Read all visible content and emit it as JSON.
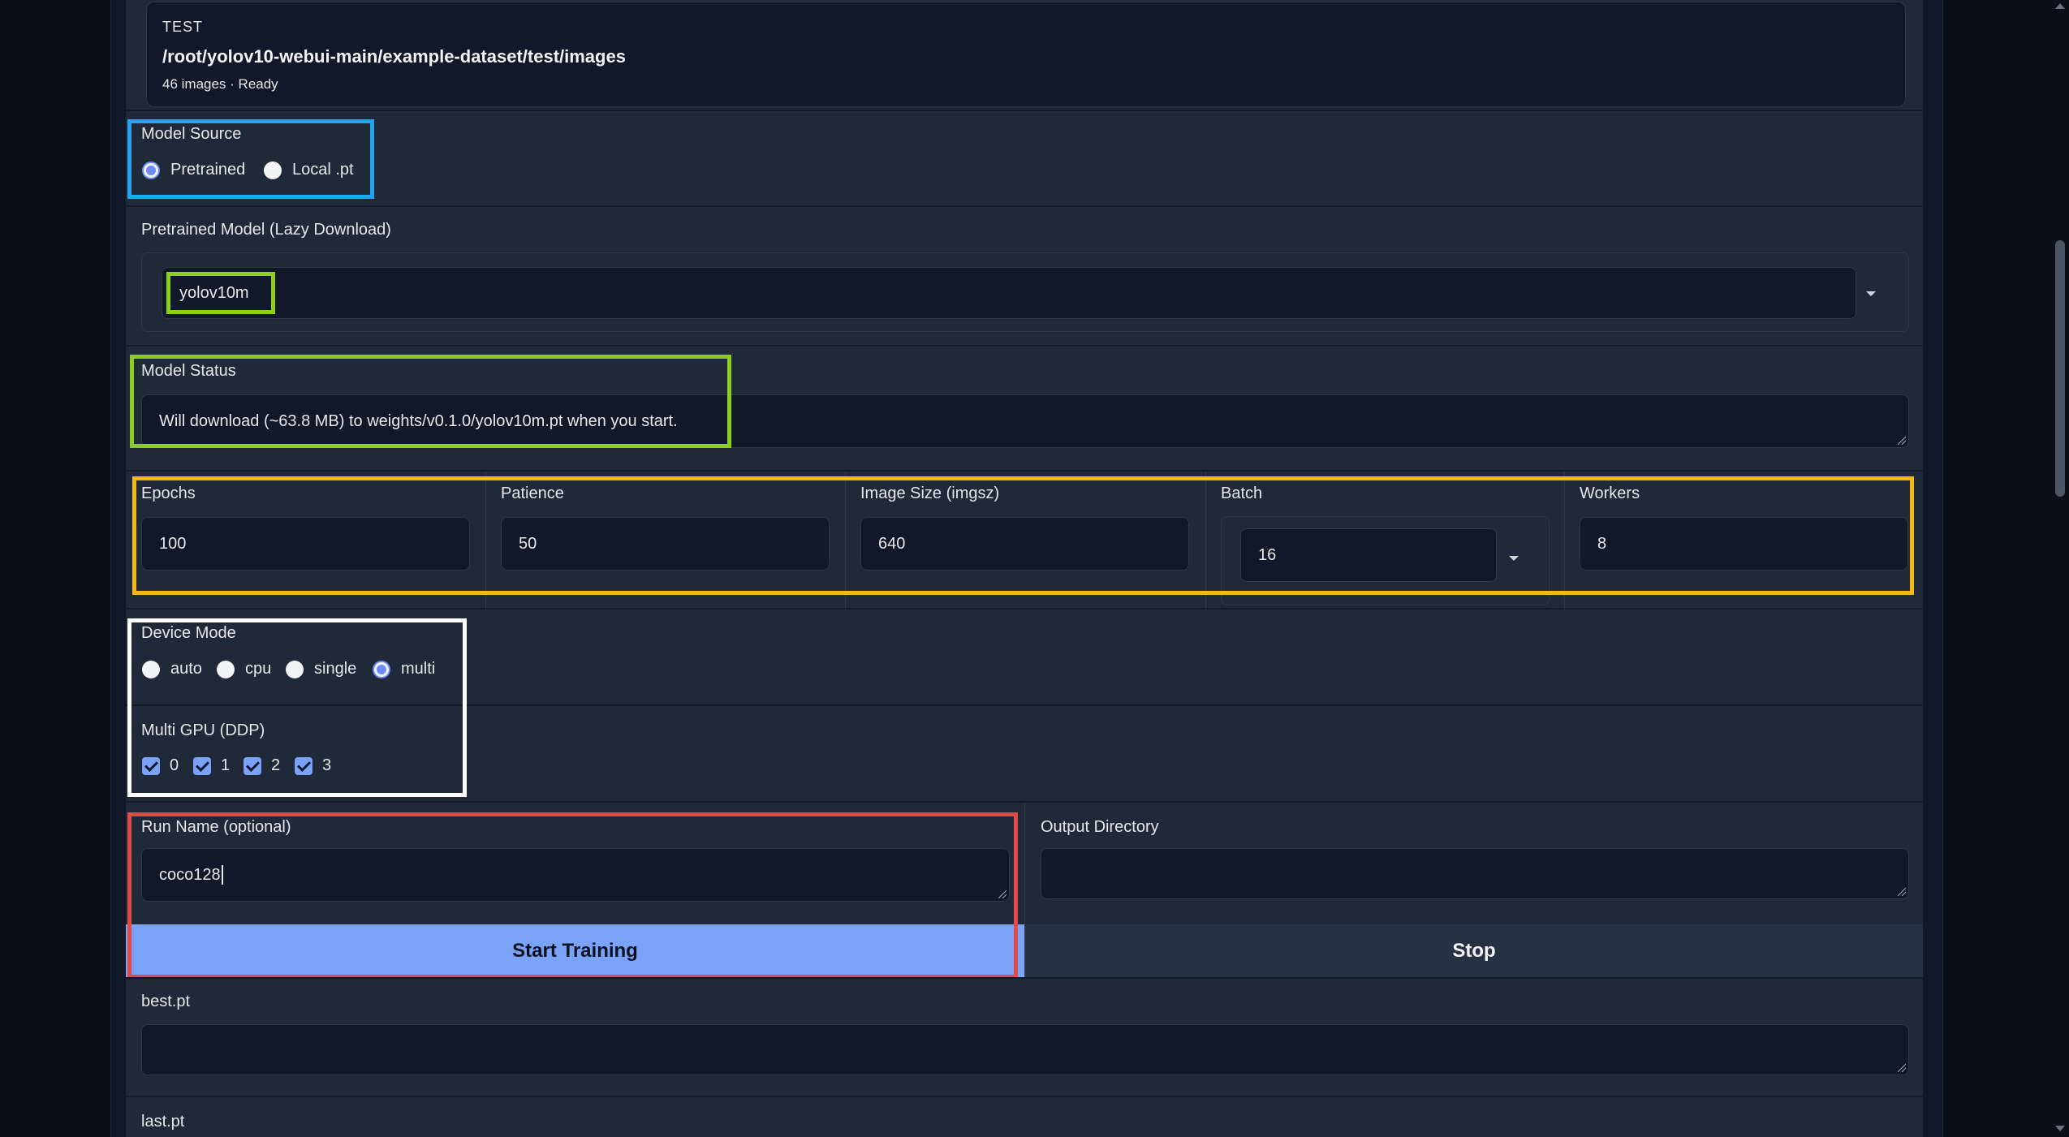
{
  "dataset": {
    "split_label": "TEST",
    "path": "/root/yolov10-webui-main/example-dataset/test/images",
    "status": "46 images · Ready"
  },
  "model_source": {
    "label": "Model Source",
    "options": [
      "Pretrained",
      "Local .pt"
    ],
    "selected": "Pretrained"
  },
  "pretrained_model": {
    "label": "Pretrained Model (Lazy Download)",
    "value": "yolov10m"
  },
  "model_status": {
    "label": "Model Status",
    "value": "Will download (~63.8 MB) to weights/v0.1.0/yolov10m.pt when you start."
  },
  "hyperparams": {
    "epochs": {
      "label": "Epochs",
      "value": "100"
    },
    "patience": {
      "label": "Patience",
      "value": "50"
    },
    "imgsz": {
      "label": "Image Size (imgsz)",
      "value": "640"
    },
    "batch": {
      "label": "Batch",
      "value": "16"
    },
    "workers": {
      "label": "Workers",
      "value": "8"
    }
  },
  "device_mode": {
    "label": "Device Mode",
    "options": [
      "auto",
      "cpu",
      "single",
      "multi"
    ],
    "selected": "multi"
  },
  "multi_gpu": {
    "label": "Multi GPU (DDP)",
    "gpus": [
      "0",
      "1",
      "2",
      "3"
    ],
    "checked": [
      "0",
      "1",
      "2",
      "3"
    ]
  },
  "run_name": {
    "label": "Run Name (optional)",
    "value": "coco128"
  },
  "output_dir": {
    "label": "Output Directory",
    "value": ""
  },
  "actions": {
    "start": "Start Training",
    "stop": "Stop"
  },
  "outputs": {
    "best_label": "best.pt",
    "best_value": "",
    "last_label": "last.pt"
  },
  "colors": {
    "accent": "#7aa2f7",
    "highlight_blue": "#1ea7f0",
    "highlight_green": "#8ccf1a",
    "highlight_orange": "#f5b915",
    "highlight_white": "#ffffff",
    "highlight_red": "#e24a4a"
  }
}
